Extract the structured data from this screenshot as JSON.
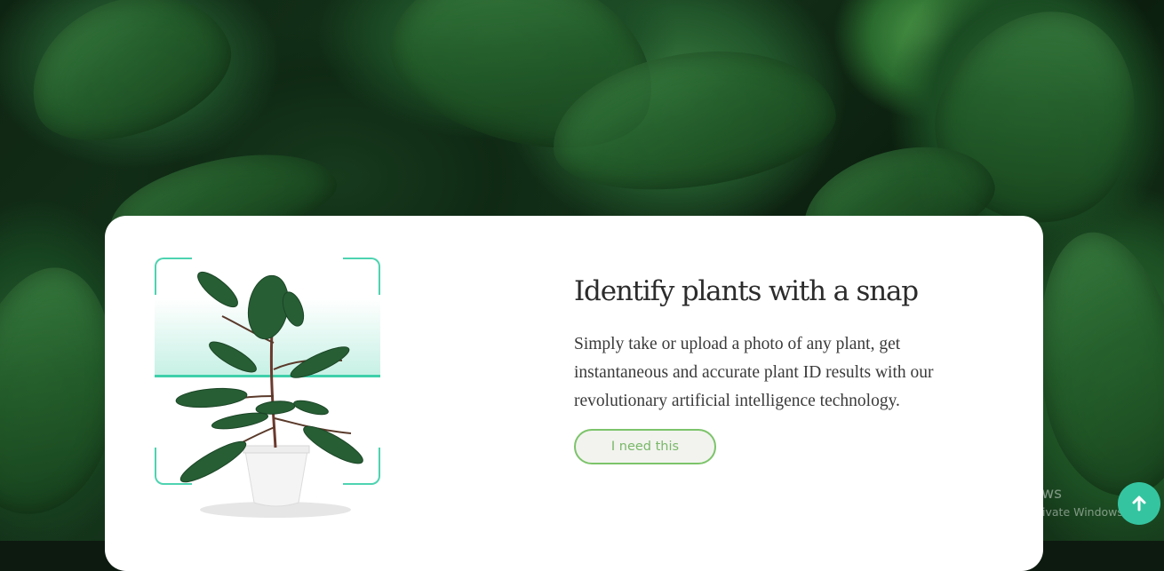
{
  "hero": {
    "title": "Identify plants with a snap",
    "description": "Simply take or upload a photo of any plant, get instantaneous and accurate plant ID results with our revolutionary artificial intelligence technology.",
    "cta_label": "I need this"
  },
  "watermark": {
    "line1": "Activate Windows",
    "line2": "Go to Settings to activate Windows."
  },
  "icons": {
    "scan_frame": "scan-frame-icon",
    "back_to_top": "arrow-up-icon"
  },
  "colors": {
    "accent_teal": "#35c4a0",
    "cta_green": "#7cc46a",
    "scan_line": "#3fd0aa"
  }
}
